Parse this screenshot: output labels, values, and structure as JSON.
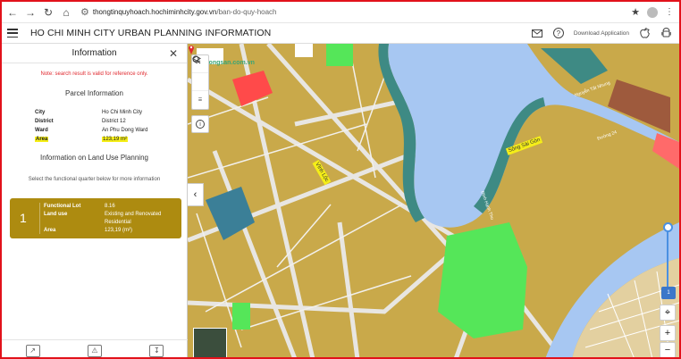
{
  "browser": {
    "url_host": "thongtinquyhoach.hochiminhcity.gov.vn",
    "url_path": "/ban-do-quy-hoach",
    "watermark": "Batdongsan.com.vn"
  },
  "header": {
    "title": "HO CHI MINH CITY URBAN PLANNING INFORMATION",
    "download_label": "Download Application"
  },
  "panel": {
    "title": "Information",
    "note": "Note: search result is valid for reference only.",
    "parcel_title": "Parcel Information",
    "parcel_rows": [
      {
        "label": "City",
        "value": "Ho Chi Minh City"
      },
      {
        "label": "District",
        "value": "District 12"
      },
      {
        "label": "Ward",
        "value": "An Phu Dong Ward"
      },
      {
        "label": "Area",
        "value": "123,19 m²"
      }
    ],
    "land_use_title": "Information on Land Use Planning",
    "select_note": "Select the functional quarter below for more information",
    "card": {
      "number": "1",
      "functional_lot_label": "Functional Lot",
      "functional_lot_value": "8.16",
      "land_use_label": "Land use",
      "land_use_value_1": "Existing and Renovated",
      "land_use_value_2": "Residential",
      "area_label": "Area",
      "area_value": "123,19 (m²)"
    }
  },
  "map": {
    "labels": {
      "road_1": "Nguyễn Tất Nhung",
      "road_2": "Đường 24",
      "river": "Sông Sài Gòn",
      "road_3": "Đình Hạnh Thu",
      "highlight_1": "Vĩnh Lộc"
    },
    "level_badge": "1",
    "colors": {
      "residential": "#c9a94a",
      "park": "#55e659",
      "water": "#a7c7f2",
      "commercial": "#ff4a4a",
      "teal": "#3e8a84",
      "public": "#3b7f97",
      "brown": "#9e5a3d"
    }
  },
  "icons": {
    "close": "close-icon",
    "search": "search-icon",
    "layers": "layers-icon",
    "info": "info-icon",
    "mail": "mail-icon",
    "help": "help-icon",
    "apple": "apple-icon",
    "android": "android-icon"
  }
}
